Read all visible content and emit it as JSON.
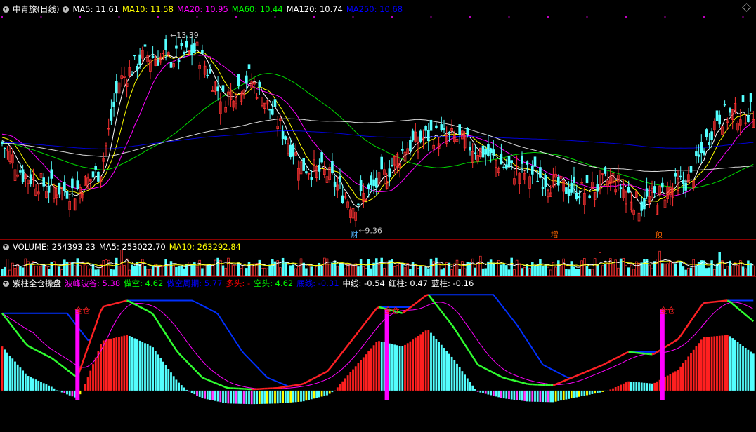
{
  "main_header": {
    "title": "中青旅(日线)",
    "items": [
      {
        "label": "MA5: 11.61",
        "color": "#ffffff"
      },
      {
        "label": "MA10: 11.58",
        "color": "#ffff00"
      },
      {
        "label": "MA20: 10.95",
        "color": "#ff00ff"
      },
      {
        "label": "MA60: 10.44",
        "color": "#00ff00"
      },
      {
        "label": "MA120: 10.74",
        "color": "#ffffff"
      },
      {
        "label": "MA250: 10.68",
        "color": "#0000ff"
      }
    ]
  },
  "volume_header": {
    "items": [
      {
        "label": "VOLUME: 254393.23",
        "color": "#ffffff"
      },
      {
        "label": "MA5: 253022.70",
        "color": "#ffffff"
      },
      {
        "label": "MA10: 263292.84",
        "color": "#ffff00"
      }
    ]
  },
  "indicator_header": {
    "title": "紫柱全仓操盘",
    "items": [
      {
        "label": "波峰波谷: 5.38",
        "color": "#ff00ff"
      },
      {
        "label": "做空: 4.62",
        "color": "#00ff00"
      },
      {
        "label": "做空周期: 5.77",
        "color": "#0000ff"
      },
      {
        "label": "多头: -",
        "color": "#ff0000"
      },
      {
        "label": "空头: 4.62",
        "color": "#00ff00"
      },
      {
        "label": "底线: -0.31",
        "color": "#0000ff"
      },
      {
        "label": "中线: -0.54",
        "color": "#ffffff"
      },
      {
        "label": "红柱: 0.47",
        "color": "#ffffff"
      },
      {
        "label": "蓝柱: -0.16",
        "color": "#ffffff"
      }
    ]
  },
  "annotations": {
    "high": "13.39",
    "low": "9.36",
    "markers": [
      "财",
      "增",
      "预"
    ],
    "signal_label": "全仓"
  },
  "chart_data": [
    {
      "type": "candlestick",
      "name": "中青旅(日线)",
      "ylim": [
        9.0,
        13.9
      ],
      "anchors": [
        [
          0,
          11.0
        ],
        [
          8,
          10.3
        ],
        [
          18,
          10.0
        ],
        [
          28,
          9.9
        ],
        [
          38,
          10.4
        ],
        [
          45,
          12.4
        ],
        [
          55,
          13.0
        ],
        [
          65,
          12.9
        ],
        [
          75,
          13.1
        ],
        [
          85,
          12.0
        ],
        [
          95,
          12.5
        ],
        [
          105,
          11.6
        ],
        [
          115,
          10.5
        ],
        [
          125,
          10.3
        ],
        [
          135,
          9.6
        ],
        [
          145,
          10.1
        ],
        [
          155,
          10.9
        ],
        [
          165,
          11.2
        ],
        [
          175,
          11.1
        ],
        [
          185,
          10.8
        ],
        [
          195,
          10.4
        ],
        [
          205,
          10.3
        ],
        [
          215,
          10.0
        ],
        [
          225,
          9.9
        ],
        [
          235,
          10.2
        ],
        [
          245,
          9.6
        ],
        [
          255,
          9.9
        ],
        [
          265,
          10.2
        ],
        [
          275,
          11.6
        ],
        [
          285,
          11.7
        ]
      ],
      "high_label_price": 13.39,
      "low_label_price": 9.36,
      "colors": {
        "up": "#ff3232",
        "down": "#54ffff"
      }
    },
    {
      "type": "bar",
      "name": "VOLUME",
      "ylim": [
        0,
        500000
      ],
      "last_value": 254393.23
    },
    {
      "type": "line",
      "name": "紫柱全仓操盘",
      "ylim": [
        -3,
        8
      ],
      "bobing": [
        6.0,
        3.5,
        2.5,
        1.0,
        6.5,
        7.0,
        6.0,
        3.0,
        1.0,
        0.2,
        0.1,
        0.2,
        0.5,
        1.5,
        4.0,
        6.5,
        6.0,
        7.5,
        5.0,
        2.0,
        1.0,
        0.5,
        0.4,
        1.2,
        2.0,
        3.0,
        2.8,
        4.0,
        6.8,
        7.0,
        5.38
      ],
      "purple_signals": [
        29,
        148,
        254
      ]
    }
  ]
}
